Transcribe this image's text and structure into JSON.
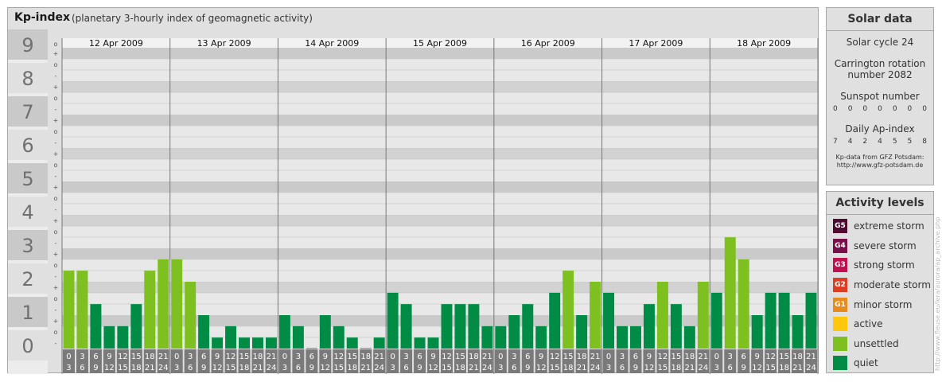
{
  "header": {
    "title": "Kp-index",
    "subtitle": "(planetary 3-hourly index of geomagnetic activity)"
  },
  "chart_data": {
    "type": "bar",
    "title": "Kp-index",
    "ylim": [
      0,
      9
    ],
    "y_ticks": [
      "0",
      "1",
      "2",
      "3",
      "4",
      "5",
      "6",
      "7",
      "8",
      "9"
    ],
    "minor_ticks": [
      "+",
      "o",
      "-"
    ],
    "days": [
      "12 Apr 2009",
      "13 Apr 2009",
      "14 Apr 2009",
      "15 Apr 2009",
      "16 Apr 2009",
      "17 Apr 2009",
      "18 Apr 2009"
    ],
    "hour_labels": [
      [
        "0",
        "3"
      ],
      [
        "3",
        "6"
      ],
      [
        "6",
        "9"
      ],
      [
        "9",
        "12"
      ],
      [
        "12",
        "15"
      ],
      [
        "15",
        "18"
      ],
      [
        "18",
        "21"
      ],
      [
        "21",
        "24"
      ]
    ],
    "values": [
      [
        2.33,
        2.33,
        1.33,
        0.67,
        0.67,
        1.33,
        2.33,
        2.67
      ],
      [
        2.67,
        2.0,
        1.0,
        0.33,
        0.67,
        0.33,
        0.33,
        0.33
      ],
      [
        1.0,
        0.67,
        0.0,
        1.0,
        0.67,
        0.33,
        0.0,
        0.33
      ],
      [
        1.67,
        1.33,
        0.33,
        0.33,
        1.33,
        1.33,
        1.33,
        0.67
      ],
      [
        0.67,
        1.0,
        1.33,
        0.67,
        1.67,
        2.33,
        1.0,
        2.0
      ],
      [
        1.67,
        0.67,
        0.67,
        1.33,
        2.0,
        1.33,
        0.67,
        2.0
      ],
      [
        1.67,
        3.33,
        2.67,
        1.0,
        1.67,
        1.67,
        1.0,
        1.67
      ]
    ],
    "colors": {
      "quiet": "#008c45",
      "unsettled": "#7dc01f",
      "active": "#fdc70e",
      "minor": "#e68b1c",
      "moderate": "#dc3d25",
      "strong": "#c3104f",
      "severe": "#780f4a",
      "extreme": "#4e0a30"
    }
  },
  "solar": {
    "title": "Solar data",
    "cycle": "Solar cycle 24",
    "carrington_1": "Carrington rotation",
    "carrington_2": "number 2082",
    "sunspot_label": "Sunspot number",
    "sunspot_values": [
      "0",
      "0",
      "0",
      "0",
      "0",
      "0",
      "0"
    ],
    "ap_label": "Daily Ap-index",
    "ap_values": [
      "7",
      "4",
      "2",
      "4",
      "5",
      "5",
      "8"
    ],
    "credit_1": "Kp-data from GFZ Potsdam:",
    "credit_2": "http://www.gfz-potsdam.de"
  },
  "activity": {
    "title": "Activity levels",
    "levels": [
      {
        "code": "G5",
        "label": "extreme storm",
        "color": "#4e0a30"
      },
      {
        "code": "G4",
        "label": "severe storm",
        "color": "#780f4a"
      },
      {
        "code": "G3",
        "label": "strong storm",
        "color": "#c3104f"
      },
      {
        "code": "G2",
        "label": "moderate storm",
        "color": "#dc3d25"
      },
      {
        "code": "G1",
        "label": "minor storm",
        "color": "#e68b1c"
      },
      {
        "code": "",
        "label": "active",
        "color": "#fdc70e"
      },
      {
        "code": "",
        "label": "unsettled",
        "color": "#7dc01f"
      },
      {
        "code": "",
        "label": "quiet",
        "color": "#008c45"
      }
    ]
  },
  "side_credit": "http://www.fleuse.eu/lera/aurora/ap_archive.php"
}
